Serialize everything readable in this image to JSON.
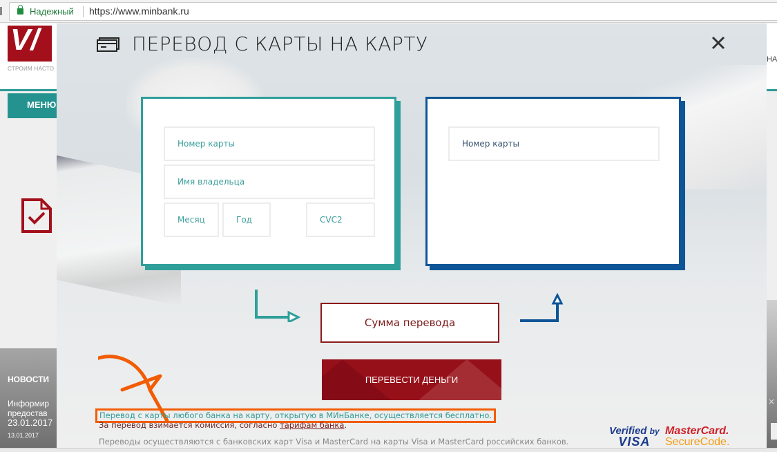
{
  "browser": {
    "security_label": "Надежный",
    "url": "https://www.minbank.ru"
  },
  "site": {
    "logo_text": "V/Л",
    "tagline": "СТРОИМ НАСТО",
    "header_right_partial": "НА",
    "menu_label": "МЕНЮ",
    "news": {
      "title": "НОВОСТИ",
      "text_line1": "Информир",
      "text_line2": "предостав",
      "text_line3": "23.01.2017",
      "date": "13.01.2017"
    },
    "right_close": "×"
  },
  "modal": {
    "title": "ПЕРЕВОД С КАРТЫ НА КАРТУ",
    "close_label": "✕",
    "from_card": {
      "card_number_placeholder": "Номер карты",
      "holder_name_placeholder": "Имя владельца",
      "month_placeholder": "Месяц",
      "year_placeholder": "Год",
      "cvc_placeholder": "CVC2"
    },
    "to_card": {
      "card_number_placeholder": "Номер карты"
    },
    "amount_placeholder": "Сумма перевода",
    "submit_label": "ПЕРЕВЕСТИ ДЕНЬГИ",
    "notes": {
      "free_transfer": "Перевод с карты любого банка на карту, открытую в МИнБанке, осуществляется бесплатно.",
      "fee_prefix": "За перевод взимается комиссия, согласно ",
      "fee_link": "тарифам банка",
      "fee_suffix": ".",
      "cards_info": "Переводы осуществляются с банковских карт Visa и MasterCard на карты Visa и MasterCard российских банков."
    },
    "badges": {
      "vbv_line1": "Verified",
      "vbv_by": "by",
      "vbv_line2": "VISA",
      "mc_line1": "MasterCard.",
      "mc_line2": "SecureCode."
    }
  },
  "colors": {
    "teal": "#2f9f9a",
    "blue": "#0d5597",
    "brand_red": "#96101a",
    "highlight_orange": "#f25c05"
  }
}
